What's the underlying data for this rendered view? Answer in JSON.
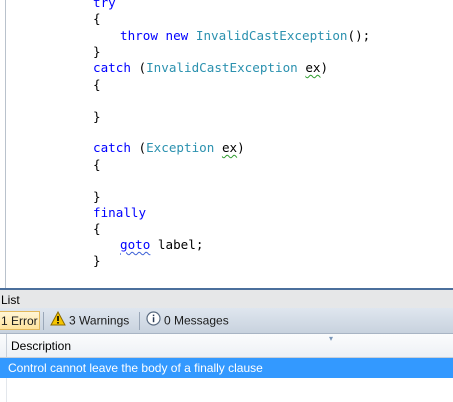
{
  "editor": {
    "lines": [
      {
        "keyword": "try"
      },
      {
        "text": "{"
      },
      {
        "kw1": "throw",
        "kw2": "new",
        "type": "InvalidCastException",
        "suffix": "();"
      },
      {
        "text": "}"
      },
      {
        "keyword": "catch",
        "open": " (",
        "type": "InvalidCastException",
        "space": " ",
        "var": "ex",
        "close": ")"
      },
      {
        "text": "{"
      },
      {
        "text": "}"
      },
      {
        "keyword": "catch",
        "open": " (",
        "type": "Exception",
        "space": " ",
        "var": "ex",
        "close": ")"
      },
      {
        "text": "{"
      },
      {
        "text": "}"
      },
      {
        "keyword": "finally"
      },
      {
        "text": "{"
      },
      {
        "keyword": "goto",
        "rest": " label;"
      },
      {
        "text": "}"
      }
    ]
  },
  "error_list": {
    "title": "List",
    "errors_button": "1 Error",
    "warnings_button": "3 Warnings",
    "messages_button": "0 Messages",
    "column_description": "Description",
    "rows": [
      {
        "description": "Control cannot leave the body of a finally clause"
      }
    ]
  },
  "colors": {
    "keyword": "#0000ff",
    "type": "#2b91af",
    "selection": "#3399ff"
  },
  "icons": {
    "warnings": "warning-icon",
    "messages": "info-icon",
    "sort": "sort-arrow-icon"
  }
}
